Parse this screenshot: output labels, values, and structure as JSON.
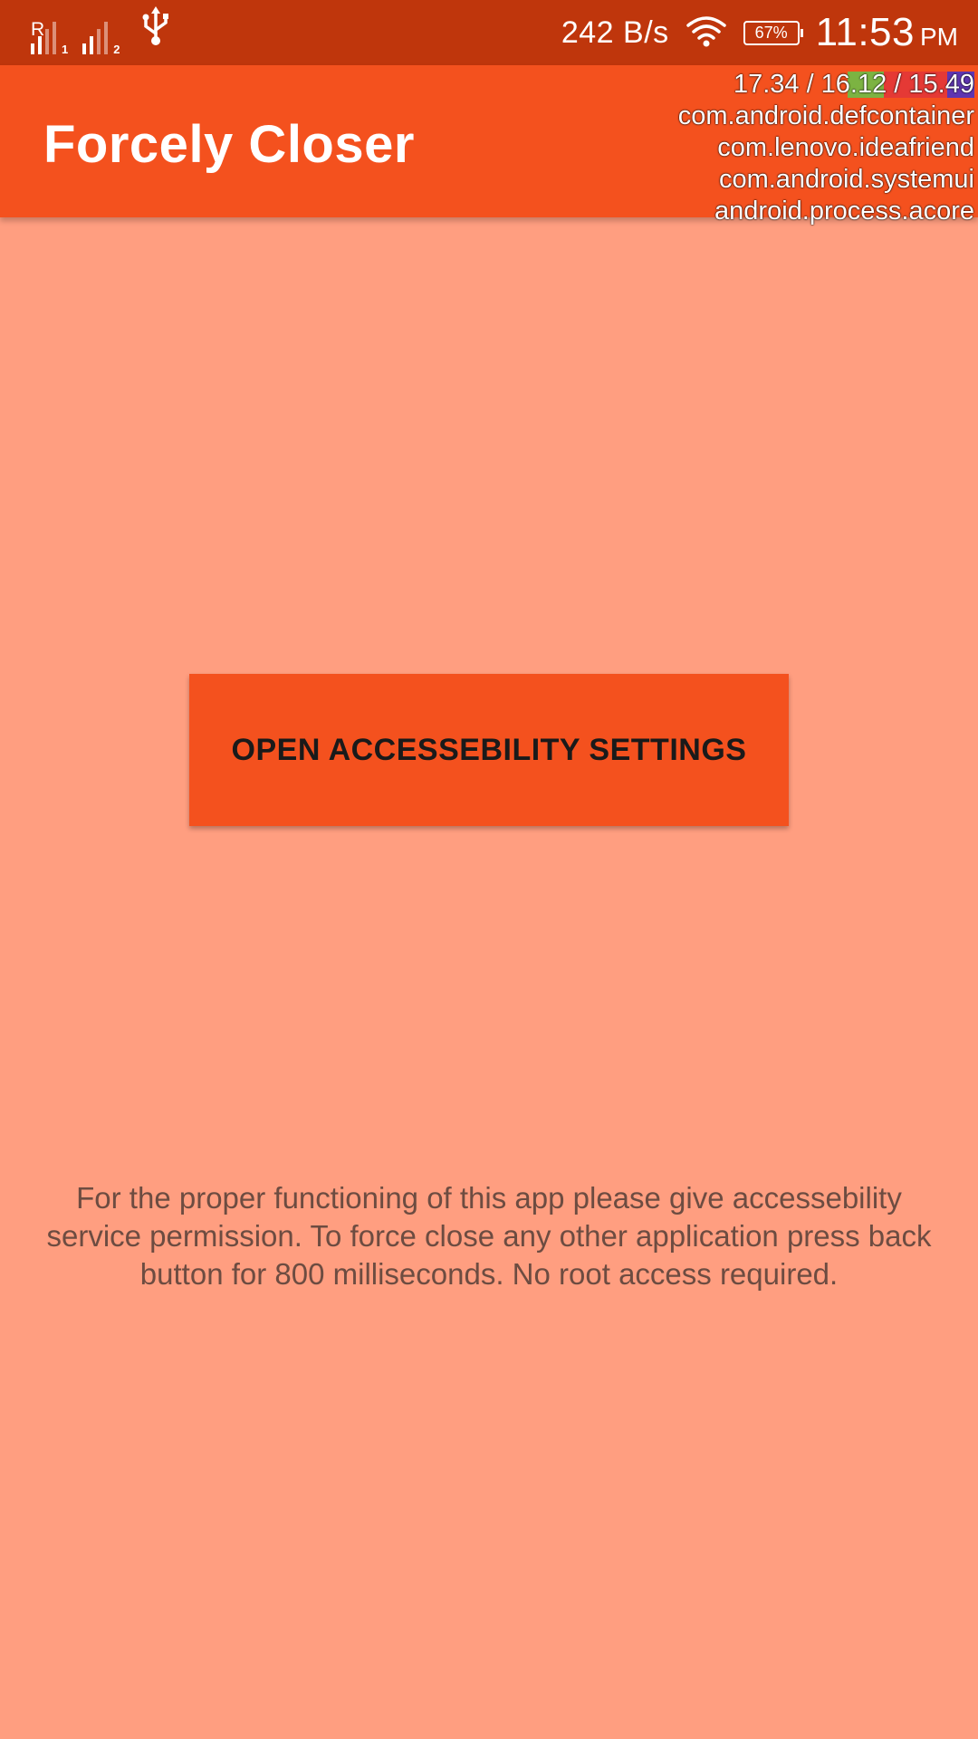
{
  "status_bar": {
    "sim1_label": "R",
    "sim1_number": "1",
    "sim2_number": "2",
    "usb_icon": "usb-icon",
    "net_speed": "242 B/s",
    "wifi_icon": "wifi-icon",
    "battery_level": "67%",
    "time": "11:53",
    "ampm": "PM"
  },
  "app_bar": {
    "title": "Forcely Closer"
  },
  "overlay": {
    "load": "17.34 / 16.12 / 15.49",
    "load_colors": [
      "#7CB342",
      "#E53935",
      "#5E35B1"
    ],
    "processes": [
      "com.android.defcontainer",
      "com.lenovo.ideafriend",
      "com.android.systemui",
      "android.process.acore"
    ]
  },
  "main": {
    "button_label": "OPEN ACCESSEBILITY SETTINGS",
    "info_text": "For the proper functioning of this app please give accessebility service permission. To force close any other application press back button for 800 milliseconds. No root access required."
  },
  "colors": {
    "status_bar": "#BF360C",
    "primary": "#F4511E",
    "background": "#FF9E80"
  }
}
